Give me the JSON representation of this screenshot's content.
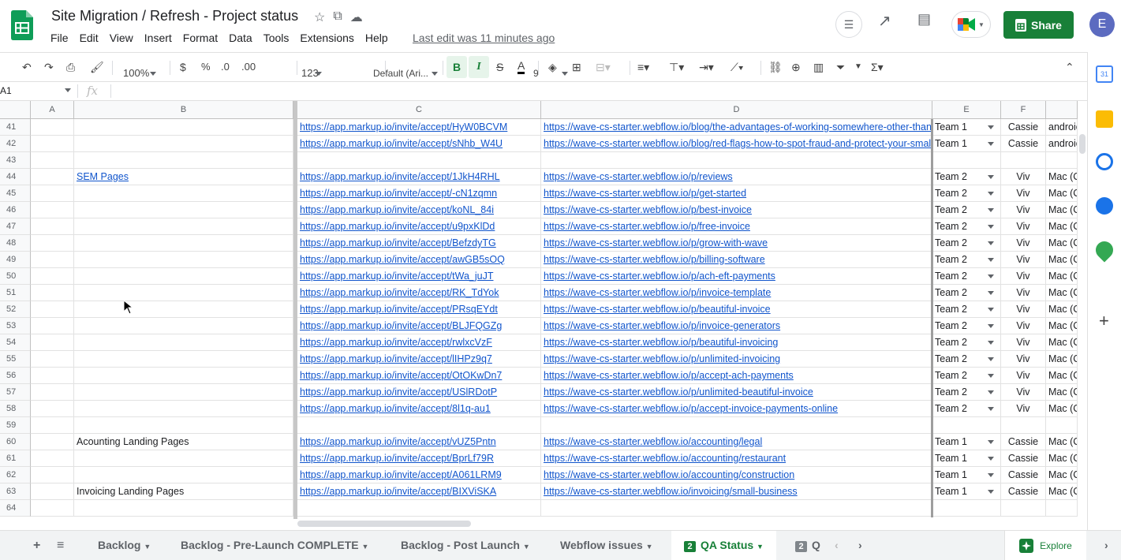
{
  "app": {
    "title": "Site Migration / Refresh - Project status",
    "last_edit": "Last edit was 11 minutes ago",
    "avatar_letter": "E",
    "share_label": "Share"
  },
  "menu": [
    "File",
    "Edit",
    "View",
    "Insert",
    "Format",
    "Data",
    "Tools",
    "Extensions",
    "Help"
  ],
  "toolbar": {
    "zoom": "100%",
    "currency": "$",
    "percent": "%",
    "dec_less": ".0",
    "dec_more": ".00",
    "number_fmt": "123",
    "font": "Default (Ari...",
    "font_size": "9",
    "bold": "B",
    "italic": "I",
    "strike": "S",
    "text_color": "A"
  },
  "formula_bar": {
    "namebox": "A1",
    "fx": "fx"
  },
  "columns": [
    "A",
    "B",
    "C",
    "D",
    "E",
    "F"
  ],
  "rows": [
    {
      "num": "41",
      "b": "",
      "c": "https://app.markup.io/invite/accept/HyW0BCVM",
      "d": "https://wave-cs-starter.webflow.io/blog/the-advantages-of-working-somewhere-other-than-you",
      "e": "Team 1",
      "f": "Cassie",
      "g": "androic"
    },
    {
      "num": "42",
      "b": "",
      "c": "https://app.markup.io/invite/accept/sNhb_W4U",
      "d": "https://wave-cs-starter.webflow.io/blog/red-flags-how-to-spot-fraud-and-protect-your-small-bu",
      "e": "Team 1",
      "f": "Cassie",
      "g": "androic"
    },
    {
      "num": "43",
      "b": "",
      "c": "",
      "d": "",
      "e": "",
      "f": "",
      "g": ""
    },
    {
      "num": "44",
      "b": "SEM Pages",
      "c": "https://app.markup.io/invite/accept/1JkH4RHL",
      "d": "https://wave-cs-starter.webflow.io/p/reviews",
      "e": "Team 2",
      "f": "Viv",
      "g": "Mac (C"
    },
    {
      "num": "45",
      "b": "",
      "c": "https://app.markup.io/invite/accept/-cN1zqmn",
      "d": "https://wave-cs-starter.webflow.io/p/get-started",
      "e": "Team 2",
      "f": "Viv",
      "g": "Mac (C"
    },
    {
      "num": "46",
      "b": "",
      "c": "https://app.markup.io/invite/accept/koNL_84i",
      "d": "https://wave-cs-starter.webflow.io/p/best-invoice",
      "e": "Team 2",
      "f": "Viv",
      "g": "Mac (C"
    },
    {
      "num": "47",
      "b": "",
      "c": "https://app.markup.io/invite/accept/u9pxKlDd",
      "d": "https://wave-cs-starter.webflow.io/p/free-invoice",
      "e": "Team 2",
      "f": "Viv",
      "g": "Mac (C"
    },
    {
      "num": "48",
      "b": "",
      "c": "https://app.markup.io/invite/accept/BefzdyTG",
      "d": "https://wave-cs-starter.webflow.io/p/grow-with-wave",
      "e": "Team 2",
      "f": "Viv",
      "g": "Mac (C"
    },
    {
      "num": "49",
      "b": "",
      "c": "https://app.markup.io/invite/accept/awGB5sOQ",
      "d": "https://wave-cs-starter.webflow.io/p/billing-software",
      "e": "Team 2",
      "f": "Viv",
      "g": "Mac (C"
    },
    {
      "num": "50",
      "b": "",
      "c": "https://app.markup.io/invite/accept/tWa_juJT",
      "d": "https://wave-cs-starter.webflow.io/p/ach-eft-payments",
      "e": "Team 2",
      "f": "Viv",
      "g": "Mac (C"
    },
    {
      "num": "51",
      "b": "",
      "c": "https://app.markup.io/invite/accept/RK_TdYok",
      "d": "https://wave-cs-starter.webflow.io/p/invoice-template",
      "e": "Team 2",
      "f": "Viv",
      "g": "Mac (C"
    },
    {
      "num": "52",
      "b": "",
      "c": "https://app.markup.io/invite/accept/PRsqEYdt",
      "d": "https://wave-cs-starter.webflow.io/p/beautiful-invoice",
      "e": "Team 2",
      "f": "Viv",
      "g": "Mac (C"
    },
    {
      "num": "53",
      "b": "",
      "c": "https://app.markup.io/invite/accept/BLJFQGZg",
      "d": "https://wave-cs-starter.webflow.io/p/invoice-generators",
      "e": "Team 2",
      "f": "Viv",
      "g": "Mac (C"
    },
    {
      "num": "54",
      "b": "",
      "c": "https://app.markup.io/invite/accept/rwlxcVzF",
      "d": "https://wave-cs-starter.webflow.io/p/beautiful-invoicing",
      "e": "Team 2",
      "f": "Viv",
      "g": "Mac (C"
    },
    {
      "num": "55",
      "b": "",
      "c": "https://app.markup.io/invite/accept/lIHPz9q7",
      "d": "https://wave-cs-starter.webflow.io/p/unlimited-invoicing",
      "e": "Team 2",
      "f": "Viv",
      "g": "Mac (C"
    },
    {
      "num": "56",
      "b": "",
      "c": "https://app.markup.io/invite/accept/OtOKwDn7",
      "d": "https://wave-cs-starter.webflow.io/p/accept-ach-payments",
      "e": "Team 2",
      "f": "Viv",
      "g": "Mac (C"
    },
    {
      "num": "57",
      "b": "",
      "c": "https://app.markup.io/invite/accept/USlRDotP",
      "d": "https://wave-cs-starter.webflow.io/p/unlimited-beautiful-invoice",
      "e": "Team 2",
      "f": "Viv",
      "g": "Mac (C"
    },
    {
      "num": "58",
      "b": "",
      "c": "https://app.markup.io/invite/accept/8l1q-au1",
      "d": "https://wave-cs-starter.webflow.io/p/accept-invoice-payments-online",
      "e": "Team 2",
      "f": "Viv",
      "g": "Mac (C"
    },
    {
      "num": "59",
      "b": "",
      "c": "",
      "d": "",
      "e": "",
      "f": "",
      "g": ""
    },
    {
      "num": "60",
      "b": "Acounting Landing Pages",
      "c": "https://app.markup.io/invite/accept/vUZ5Pntn",
      "d": "https://wave-cs-starter.webflow.io/accounting/legal",
      "e": "Team 1",
      "f": "Cassie",
      "g": "Mac (C"
    },
    {
      "num": "61",
      "b": "",
      "c": "https://app.markup.io/invite/accept/BprLf79R",
      "d": "https://wave-cs-starter.webflow.io/accounting/restaurant",
      "e": "Team 1",
      "f": "Cassie",
      "g": "Mac (C"
    },
    {
      "num": "62",
      "b": "",
      "c": "https://app.markup.io/invite/accept/A061LRM9",
      "d": "https://wave-cs-starter.webflow.io/accounting/construction",
      "e": "Team 1",
      "f": "Cassie",
      "g": "Mac (C"
    },
    {
      "num": "63",
      "b": "Invoicing Landing Pages",
      "c": "https://app.markup.io/invite/accept/BIXViSKA",
      "d": "https://wave-cs-starter.webflow.io/invoicing/small-business",
      "e": "Team 1",
      "f": "Cassie",
      "g": "Mac (C"
    },
    {
      "num": "64",
      "b": "",
      "c": "",
      "d": "",
      "e": "",
      "f": "",
      "g": ""
    }
  ],
  "tabs": {
    "backlog": "Backlog",
    "prelaunch": "Backlog - Pre-Launch COMPLETE",
    "postlaunch": "Backlog - Post Launch",
    "webflow": "Webflow issues",
    "qa_badge": "2",
    "qa": "QA Status",
    "next_badge": "2",
    "next": "Q",
    "explore": "Explore"
  },
  "colors": {
    "brand": "#188038",
    "link": "#1155cc"
  }
}
